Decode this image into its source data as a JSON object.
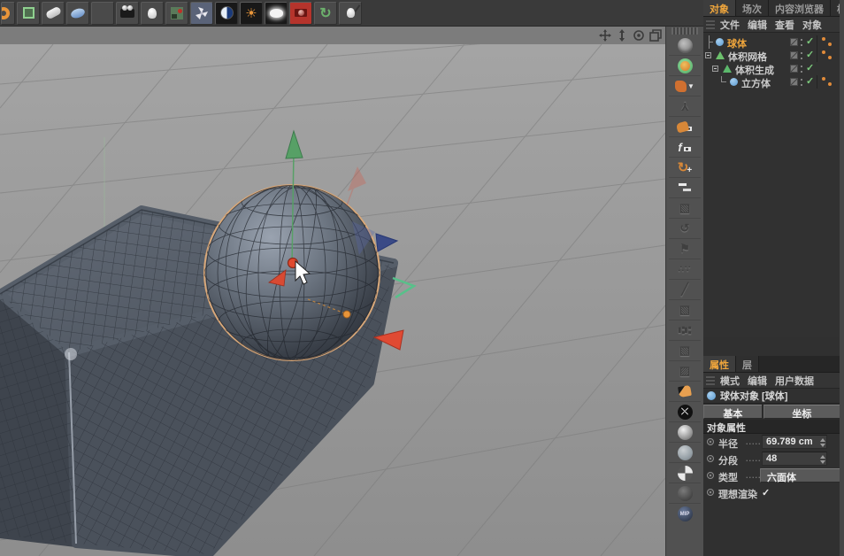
{
  "top_toolbar": {
    "icon_names": [
      "partial-tool-icon",
      "make-editable-icon",
      "sweep-capsule-icon",
      "disc-icon",
      "floor-grid-icon",
      "camera-icon",
      "light-icon",
      "stage-icon",
      "motor-fan-icon",
      "contrast-sphere-icon",
      "sun-light-icon",
      "sky-icon",
      "render-view-icon",
      "render-settings-icon",
      "light-wand-icon"
    ]
  },
  "viewport": {
    "nav_icon_names": [
      "pan-icon",
      "dolly-icon",
      "rotate-icon",
      "toggle-view-icon"
    ]
  },
  "side_toolbar": {
    "icon_names": [
      "wire-sphere-icon",
      "volume-sphere-icon",
      "mesh-reduce-icon",
      "joint-icon",
      "hand-eye-icon",
      "fcurve-eye-icon",
      "reset-psr-icon",
      "notes-icon",
      "cube-gray-icon",
      "recycle-icon",
      "flag-icon",
      "dots-icon",
      "knife-icon",
      "cube2-gray-icon",
      "sliders-icon",
      "cube3-gray-icon",
      "open-cube-icon",
      "spline-pen-icon",
      "swap-icon",
      "shiny-sphere-icon",
      "glass-sphere-icon",
      "checker-sphere-icon",
      "dark-sphere-icon",
      "mip-sphere-icon"
    ]
  },
  "object_manager": {
    "tabs": [
      "对象",
      "场次",
      "内容浏览器",
      "构"
    ],
    "active_tab": "对象",
    "menu": [
      "文件",
      "编辑",
      "查看",
      "对象"
    ],
    "tree": [
      {
        "label": "球体",
        "selected": true,
        "enabled": "✓"
      },
      {
        "label": "体积网格",
        "selected": false,
        "enabled": "✓"
      },
      {
        "label": "体积生成",
        "selected": false,
        "enabled": "✓"
      },
      {
        "label": "立方体",
        "selected": false,
        "enabled": "✓"
      }
    ]
  },
  "attribute_manager": {
    "tabs": [
      "属性",
      "层"
    ],
    "active_tab": "属性",
    "menu": [
      "模式",
      "编辑",
      "用户数据"
    ],
    "object_title": "球体对象 [球体]",
    "section_tabs": [
      "基本",
      "坐标"
    ],
    "section_header": "对象属性",
    "props": {
      "radius": {
        "label": "半径",
        "dots": ".....",
        "value": "69.789 cm"
      },
      "segments": {
        "label": "分段",
        "dots": ".....",
        "value": "48"
      },
      "type": {
        "label": "类型",
        "dots": ".....",
        "value": "六面体"
      },
      "render_perfect": {
        "label": "理想渲染",
        "check": "✓"
      }
    }
  },
  "colors": {
    "accent_orange": "#f0a63c",
    "check_green": "#7cc87c",
    "axis_green": "#57a066",
    "axis_red": "#e04a33",
    "axis_blue": "#3a4a86",
    "handle_orange": "#e8953a",
    "selection_outline": "#d9a879"
  }
}
